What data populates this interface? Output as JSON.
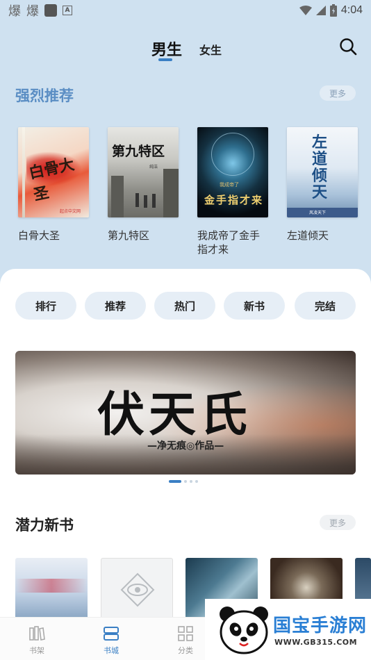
{
  "status_bar": {
    "left_glyphs": [
      "爆",
      "爆"
    ],
    "time": "4:04"
  },
  "top_tabs": {
    "male": "男生",
    "female": "女生",
    "active": "男生"
  },
  "recommended": {
    "title": "强烈推荐",
    "more": "更多",
    "books": [
      {
        "title": "白骨大圣",
        "cover_text": "白骨大圣",
        "cover_brand": "起点中文网"
      },
      {
        "title": "第九特区",
        "cover_text": "第九特区",
        "cover_author": "纯洁"
      },
      {
        "title": "我成帝了金手指才来",
        "cover_text": "金手指才来",
        "cover_sub": "我成帝了"
      },
      {
        "title": "左道倾天",
        "cover_text": "左道倾天",
        "cover_author": "风凌天下"
      }
    ]
  },
  "categories": [
    "排行",
    "推荐",
    "热门",
    "新书",
    "完结"
  ],
  "banner": {
    "title": "伏天氏",
    "subtitle": "—净无痕◎作品—",
    "slides": 4,
    "active_slide": 0
  },
  "potential": {
    "title": "潜力新书",
    "more": "更多"
  },
  "bottom_nav": [
    {
      "label": "书架",
      "icon": "bookshelf-icon"
    },
    {
      "label": "书城",
      "icon": "bookstore-icon",
      "active": true
    },
    {
      "label": "分类",
      "icon": "category-icon"
    }
  ],
  "watermark": {
    "brand": "国宝手游网",
    "url": "WWW.GB315.COM"
  },
  "colors": {
    "accent": "#3a7fc4",
    "header_bg": "#cfe1f0",
    "section_title": "#5b8ec4"
  }
}
